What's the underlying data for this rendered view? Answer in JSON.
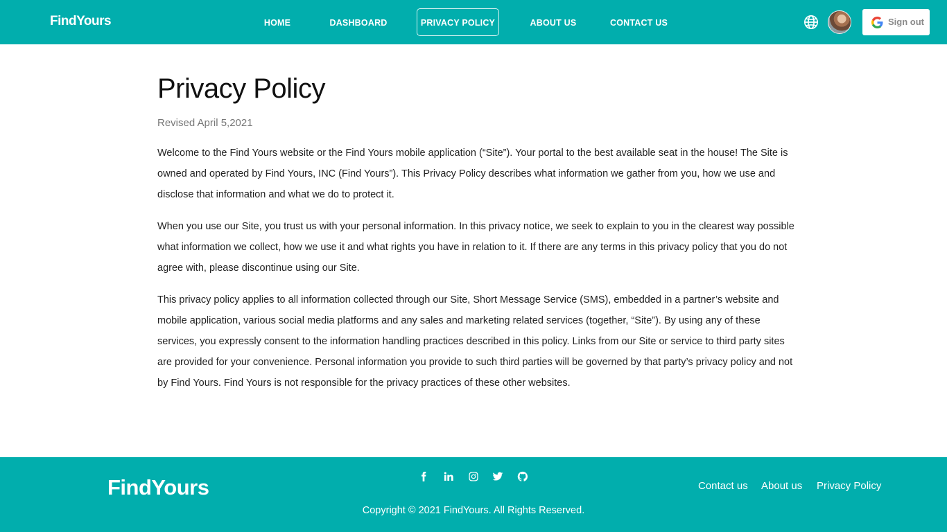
{
  "header": {
    "brand": "FindYours",
    "nav": [
      {
        "label": "HOME"
      },
      {
        "label": "DASHBOARD"
      },
      {
        "label": "PRIVACY POLICY"
      },
      {
        "label": "ABOUT US"
      },
      {
        "label": "CONTACT US"
      }
    ],
    "active_nav": "PRIVACY POLICY",
    "globe_icon": "globe-icon",
    "signout_label": "Sign out"
  },
  "main": {
    "title": "Privacy Policy",
    "revised": "Revised April 5,2021",
    "paragraphs": [
      "Welcome to the Find Yours website or the Find Yours mobile application (“Site”). Your portal to the best available seat in the house! The Site is owned and operated by Find Yours, INC (Find Yours”). This Privacy Policy describes what information we gather from you, how we use and disclose that information and what we do to protect it.",
      "When you use our Site, you trust us with your personal information. In this privacy notice, we seek to explain to you in the clearest way possible what information we collect, how we use it and what rights you have in relation to it. If there are any terms in this privacy policy that you do not agree with, please discontinue using our Site.",
      "This privacy policy applies to all information collected through our Site, Short Message Service (SMS), embedded in a partner’s website and mobile application, various social media platforms and any sales and marketing related services (together, “Site”). By using any of these services, you expressly consent to the information handling practices described in this policy. Links from our Site or service to third party sites are provided for your convenience. Personal information you provide to such third parties will be governed by that party’s privacy policy and not by Find Yours. Find Yours is not responsible for the privacy practices of these other websites."
    ]
  },
  "footer": {
    "brand": "FindYours",
    "social": [
      "facebook-icon",
      "linkedin-icon",
      "instagram-icon",
      "twitter-icon",
      "github-icon"
    ],
    "links": [
      {
        "label": "Contact us"
      },
      {
        "label": "About us"
      },
      {
        "label": "Privacy Policy"
      }
    ],
    "copyright": "Copyright © 2021 FindYours. All Rights Reserved."
  },
  "colors": {
    "primary": "#01aead",
    "text": "#222222",
    "muted": "#777777"
  }
}
